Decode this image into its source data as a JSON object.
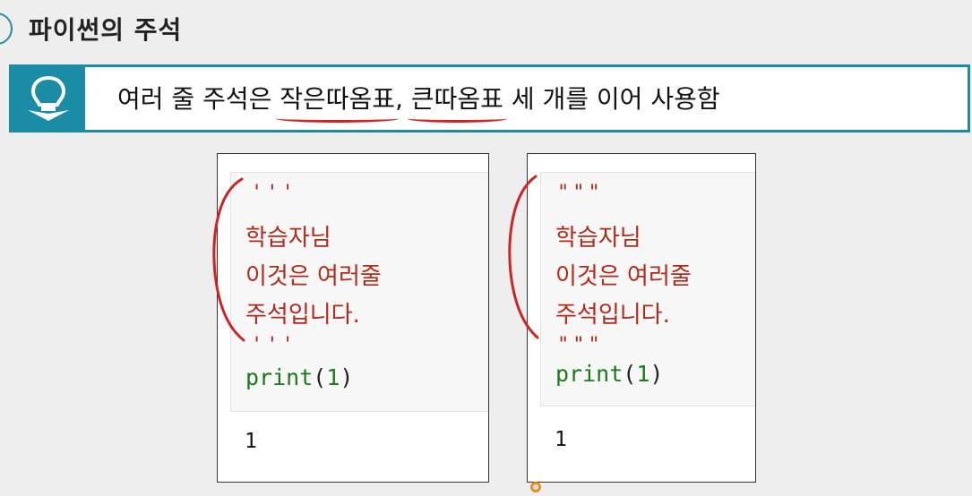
{
  "page_title": "파이썬의 주석",
  "banner": {
    "icon": "lightbulb-icon",
    "text_before": "여러 줄 주석은 ",
    "highlight_1": "작은따옴표",
    "text_mid": ", ",
    "highlight_2": "큰따옴표",
    "text_after": " 세 개를 이어 사용함"
  },
  "examples": [
    {
      "open_quote": "'''",
      "comment_lines": [
        "학습자님",
        "이것은  여러줄",
        "주석입니다."
      ],
      "close_quote": "'''",
      "code_fn": "print",
      "code_open": "(",
      "code_arg": "1",
      "code_close": ")",
      "output": "1"
    },
    {
      "open_quote": "\"\"\"",
      "comment_lines": [
        "학습자님",
        "이것은  여러줄",
        "주석입니다."
      ],
      "close_quote": "\"\"\"",
      "code_fn": "print",
      "code_open": "(",
      "code_arg": "1",
      "code_close": ")",
      "output": "1"
    }
  ],
  "colors": {
    "accent": "#1a8ca6",
    "comment": "#b22a1a",
    "keyword": "#1c7a1c",
    "annotation": "#d02424",
    "pointer": "#f08a1c"
  }
}
